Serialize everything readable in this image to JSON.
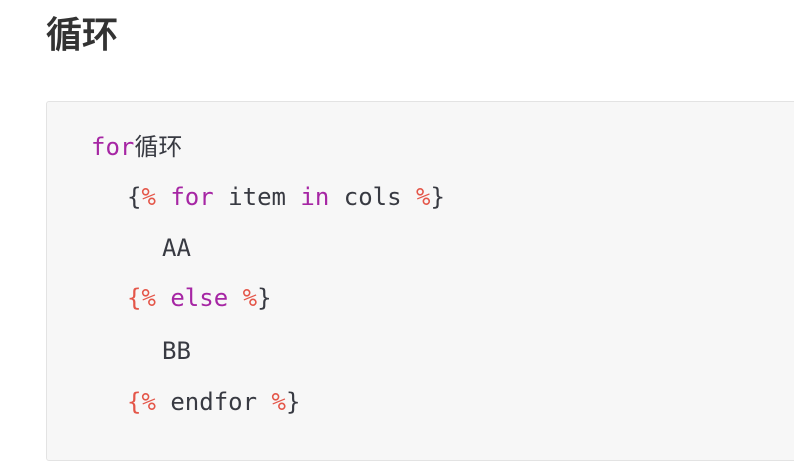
{
  "heading": "循环",
  "code": {
    "line1": {
      "keyword": "for",
      "label": "循环"
    },
    "line2": {
      "open_brace": "{",
      "open_pct": "%",
      "kw_for": "for",
      "var": " item ",
      "kw_in": "in",
      "iterable": " cols ",
      "close_pct": "%",
      "close_brace": "}"
    },
    "line3": {
      "text": "AA"
    },
    "line4": {
      "open_brace": "{",
      "open_pct": "%",
      "kw_else": "else",
      "close_pct": "%",
      "close_brace": "}"
    },
    "line5": {
      "text": "BB"
    },
    "line6": {
      "open_brace": "{",
      "open_pct": "%",
      "kw_endfor": "endfor",
      "close_pct": "%",
      "close_brace": "}"
    }
  },
  "colors": {
    "keyword": "#a626a4",
    "delimiter": "#e45649",
    "text": "#383a42",
    "code_background": "#f7f7f7"
  }
}
